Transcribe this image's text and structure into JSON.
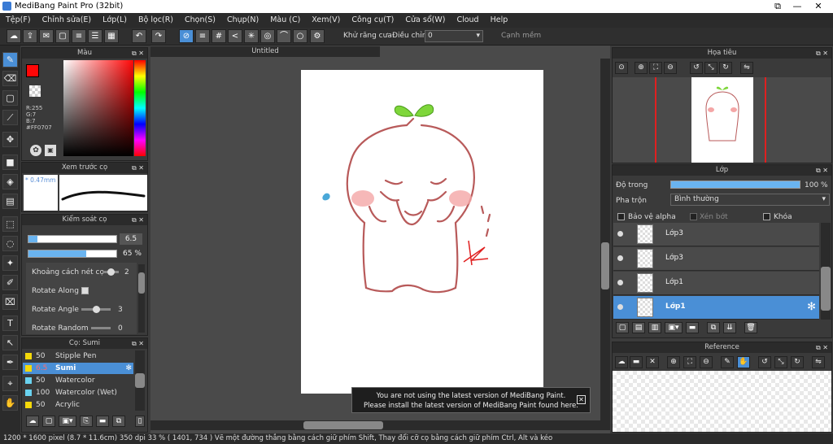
{
  "window": {
    "title": "MediBang Paint Pro (32bit)",
    "min": "—",
    "max": "☐",
    "close": "✕",
    "restore": "⧉"
  },
  "menu": [
    "Tệp(F)",
    "Chỉnh sửa(E)",
    "Lớp(L)",
    "Bộ lọc(R)",
    "Chọn(S)",
    "Chụp(N)",
    "Màu (C)",
    "Xem(V)",
    "Công cụ(T)",
    "Cửa sổ(W)",
    "Cloud",
    "Help"
  ],
  "toolbar": {
    "antialias_label": "Khử răng cưa",
    "correction_label": "Điều chỉnh",
    "correction_value": "0",
    "edge_label": "Cạnh mềm"
  },
  "color_panel": {
    "title": "Màu",
    "r": "R:255",
    "g": "G:7",
    "b": "B:7",
    "hex": "#FF0707",
    "primary": "#ff0707"
  },
  "brush_preview": {
    "title": "Xem trước cọ",
    "size": "0.47mm"
  },
  "brush_control": {
    "title": "Kiểm soát cọ",
    "size_value": "6.5",
    "opacity_value": "65 %",
    "spacing_label": "Khoảng cách nét cọ",
    "spacing_value": "2",
    "rotate_along_label": "Rotate Along",
    "rotate_angle_label": "Rotate Angle",
    "rotate_angle_value": "3",
    "rotate_random_label": "Rotate Random",
    "rotate_random_value": "0"
  },
  "brush_list": {
    "title": "Cọ: Sumi",
    "items": [
      {
        "size": "50",
        "name": "Stipple Pen",
        "color": "#f5d90a"
      },
      {
        "size": "6.5",
        "name": "Sumi",
        "color": "#f5d90a"
      },
      {
        "size": "50",
        "name": "Watercolor",
        "color": "#6ad3f0"
      },
      {
        "size": "100",
        "name": "Watercolor (Wet)",
        "color": "#6ad3f0"
      },
      {
        "size": "50",
        "name": "Acrylic",
        "color": "#f5d90a"
      }
    ]
  },
  "document": {
    "tab": "Untitled"
  },
  "notice": {
    "line1": "You are not using the latest version of MediBang Paint.",
    "line2": "Please install the latest version of MediBang Paint found here."
  },
  "navigator": {
    "title": "Họa tiêu"
  },
  "layers": {
    "title": "Lớp",
    "opacity_label": "Độ trong",
    "opacity_value": "100 %",
    "blend_label": "Pha trộn",
    "blend_value": "Bình thường",
    "protect_alpha": "Bảo vệ alpha",
    "clipping": "Xén bớt",
    "lock": "Khóa",
    "items": [
      {
        "name": "Lớp3",
        "selected": false
      },
      {
        "name": "Lớp3",
        "selected": false
      },
      {
        "name": "Lớp1",
        "selected": false
      },
      {
        "name": "Lớp1",
        "selected": true
      }
    ]
  },
  "reference": {
    "title": "Reference"
  },
  "status": {
    "text": "1200 * 1600 pixel   (8.7 * 11.6cm)   350 dpi   33 %   ( 1401, 734 )   Vẽ một đường thẳng bằng cách giữ phím Shift, Thay đổi cỡ cọ bằng cách giữ phím Ctrl, Alt và kéo"
  }
}
